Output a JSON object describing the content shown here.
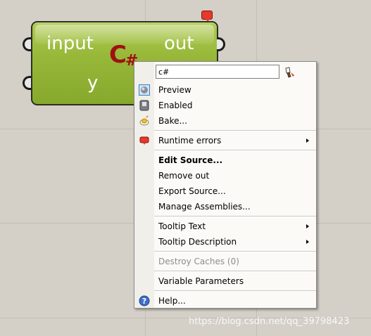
{
  "component": {
    "input_left_1": "input",
    "input_left_2": "y",
    "output_right": "out",
    "logo": "C",
    "logo_hash": "#"
  },
  "menu": {
    "name_field_value": "c#",
    "items": [
      {
        "label": "Preview",
        "icon": "preview-icon"
      },
      {
        "label": "Enabled",
        "icon": "enabled-icon"
      },
      {
        "label": "Bake...",
        "icon": "bake-icon"
      },
      {
        "label": "Runtime errors",
        "icon": "runtime-errors-icon",
        "submenu": true
      },
      {
        "label": "Edit Source...",
        "bold": true
      },
      {
        "label": "Remove out"
      },
      {
        "label": "Export Source..."
      },
      {
        "label": "Manage Assemblies..."
      },
      {
        "label": "Tooltip Text",
        "submenu": true
      },
      {
        "label": "Tooltip Description",
        "submenu": true
      },
      {
        "label": "Destroy Caches (0)",
        "disabled": true
      },
      {
        "label": "Variable Parameters"
      },
      {
        "label": "Help...",
        "icon": "help-icon"
      }
    ]
  },
  "watermark": "https://blog.csdn.net/qq_39798423",
  "colors": {
    "canvas_bg": "#d4d0c8",
    "component_green": "#98b83a",
    "logo_red": "#a01010",
    "menu_bg": "#fbfaf7"
  }
}
